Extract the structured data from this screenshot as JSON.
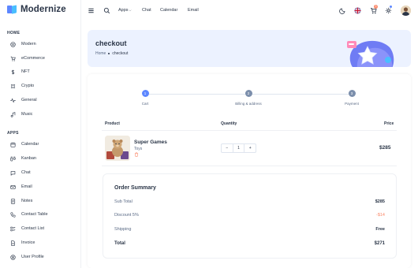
{
  "app": {
    "name": "Modernize",
    "accent": "#5D87FF"
  },
  "sidebar": {
    "sections": [
      {
        "title": "HOME",
        "items": [
          {
            "label": "Modern",
            "icon": "aperture-icon"
          },
          {
            "label": "eCommerce",
            "icon": "shopping-cart-icon"
          },
          {
            "label": "NFT",
            "icon": "currency-dollar-icon"
          },
          {
            "label": "Crypto",
            "icon": "currency-icon"
          },
          {
            "label": "General",
            "icon": "activity-heartbeat-icon"
          },
          {
            "label": "Music",
            "icon": "music-icon"
          }
        ]
      },
      {
        "title": "APPS",
        "items": [
          {
            "label": "Calendar",
            "icon": "calendar-icon"
          },
          {
            "label": "Kanban",
            "icon": "layout-kanban-icon"
          },
          {
            "label": "Chat",
            "icon": "message-icon"
          },
          {
            "label": "Email",
            "icon": "mail-icon"
          },
          {
            "label": "Notes",
            "icon": "notes-icon"
          },
          {
            "label": "Contact Table",
            "icon": "phone-icon"
          },
          {
            "label": "Contact List",
            "icon": "list-details-icon"
          },
          {
            "label": "Invoice",
            "icon": "file-text-icon"
          },
          {
            "label": "User Profile",
            "icon": "user-circle-icon"
          }
        ]
      }
    ]
  },
  "header": {
    "links": [
      "Apps",
      "Chat",
      "Calendar",
      "Email"
    ],
    "cart_badge": "3"
  },
  "banner": {
    "title": "checkout",
    "breadcrumb": [
      "Home",
      "checkout"
    ]
  },
  "stepper": {
    "steps": [
      {
        "num": "1",
        "label": "Cart",
        "active": true
      },
      {
        "num": "2",
        "label": "Billing & address",
        "active": false
      },
      {
        "num": "3",
        "label": "Payment",
        "active": false
      }
    ]
  },
  "table": {
    "headers": {
      "product": "Product",
      "quantity": "Quantity",
      "price": "Price"
    },
    "rows": [
      {
        "name": "Super Games",
        "category": "Toys",
        "qty": "1",
        "price": "$285"
      }
    ],
    "qty_minus": "−",
    "qty_plus": "+"
  },
  "summary": {
    "title": "Order Summary",
    "rows": [
      {
        "label": "Sub Total",
        "value": "$285"
      },
      {
        "label": "Discount 5%",
        "value": "-$14"
      },
      {
        "label": "Shipping",
        "value": "Free"
      },
      {
        "label": "Total",
        "value": "$271"
      }
    ]
  }
}
